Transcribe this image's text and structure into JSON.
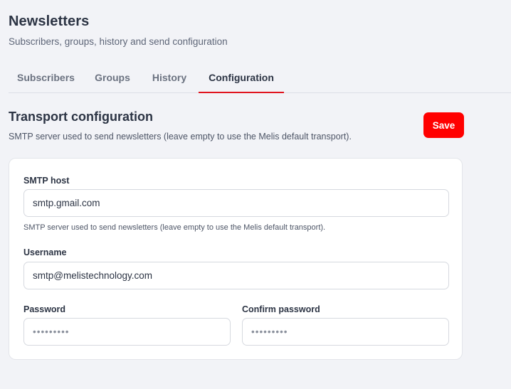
{
  "header": {
    "title": "Newsletters",
    "subtitle": "Subscribers, groups, history and send configuration"
  },
  "tabs": [
    {
      "label": "Subscribers",
      "active": false
    },
    {
      "label": "Groups",
      "active": false
    },
    {
      "label": "History",
      "active": false
    },
    {
      "label": "Configuration",
      "active": true
    }
  ],
  "section": {
    "title": "Transport configuration",
    "description": "SMTP server used to send newsletters (leave empty to use the Melis default transport).",
    "save_label": "Save"
  },
  "form": {
    "smtp_host": {
      "label": "SMTP host",
      "value": "smtp.gmail.com",
      "hint": "SMTP server used to send newsletters (leave empty to use the Melis default transport)."
    },
    "username": {
      "label": "Username",
      "value": "smtp@melistechnology.com"
    },
    "password": {
      "label": "Password",
      "value": "•••••••••"
    },
    "confirm_password": {
      "label": "Confirm password",
      "value": "•••••••••"
    }
  },
  "colors": {
    "accent": "#ff0000",
    "tab_underline": "#e0141e",
    "background": "#f2f3f7"
  }
}
